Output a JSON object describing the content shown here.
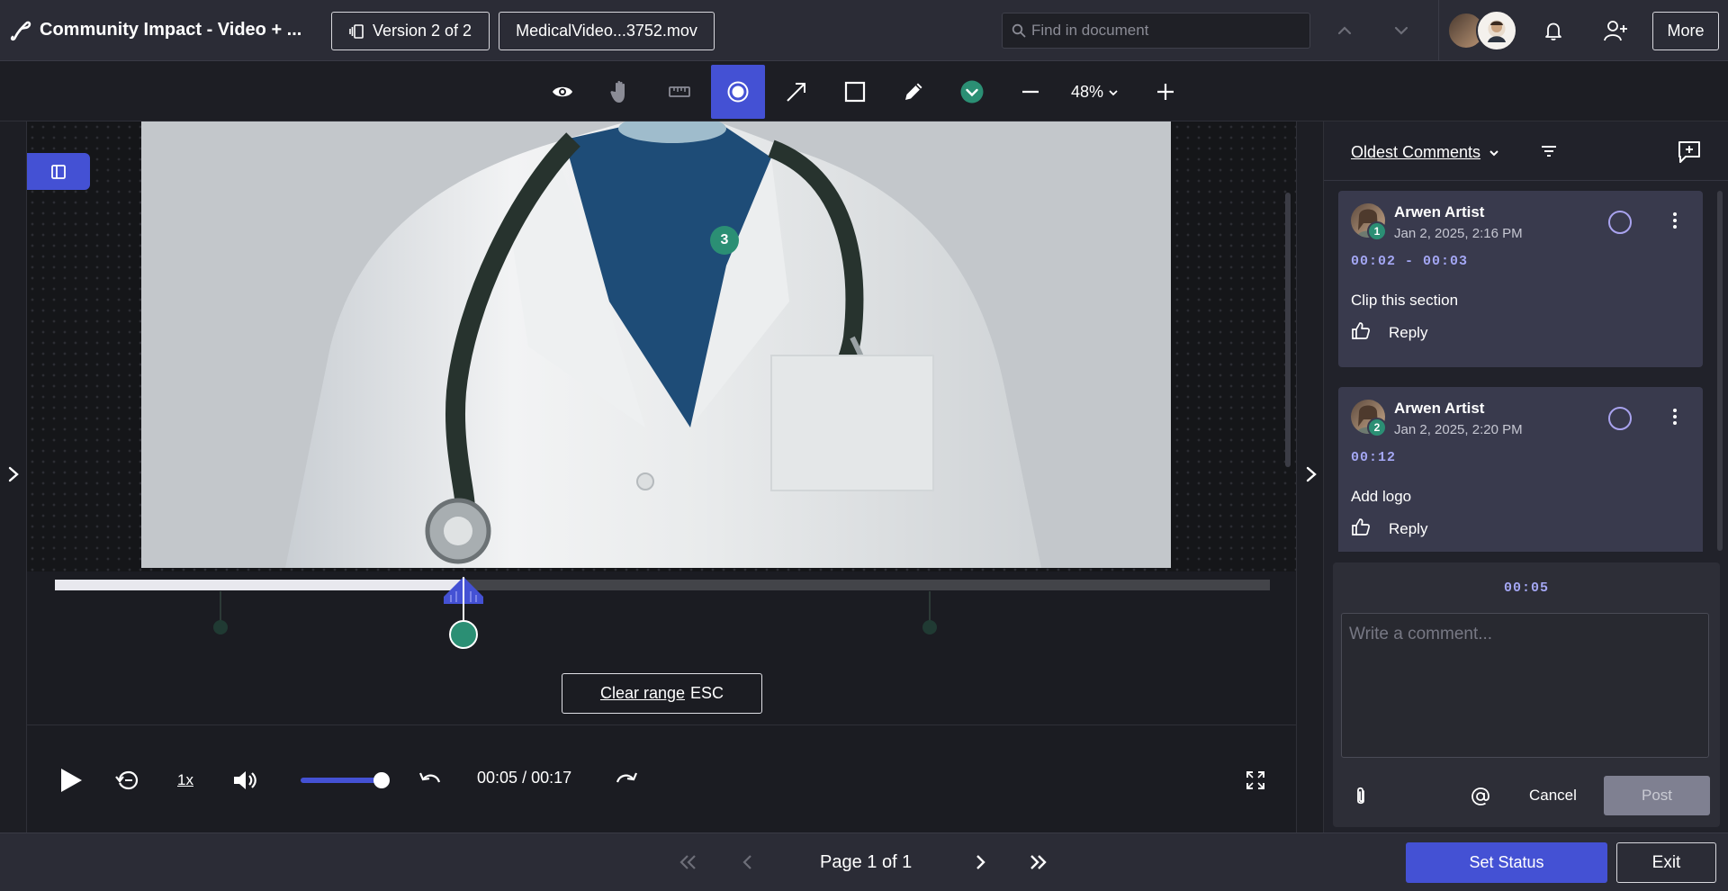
{
  "header": {
    "title": "Community Impact - Video + ...",
    "version_label": "Version 2 of 2",
    "file_label": "MedicalVideo...3752.mov",
    "search_placeholder": "Find in document",
    "more_label": "More"
  },
  "toolbar": {
    "zoom_level": "48%",
    "tools": [
      "eye-icon",
      "hand-icon",
      "ruler-icon",
      "record-icon",
      "arrow-icon",
      "square-icon",
      "pencil-icon",
      "status-check-icon"
    ],
    "active_tool": "record-icon"
  },
  "stage": {
    "marker_number": "3"
  },
  "timeline": {
    "progress_fraction": 0.336,
    "clear_range_label": "Clear range",
    "clear_range_key": "ESC"
  },
  "player": {
    "speed": "1x",
    "current_time": "00:05",
    "separator": "/",
    "duration": "00:17",
    "volume_fraction": 1.0
  },
  "sidebar": {
    "sort_label": "Oldest Comments",
    "comments": [
      {
        "number": "1",
        "author": "Arwen Artist",
        "date": "Jan 2, 2025, 2:16 PM",
        "time": "00:02 - 00:03",
        "text": "Clip this section",
        "reply_label": "Reply"
      },
      {
        "number": "2",
        "author": "Arwen Artist",
        "date": "Jan 2, 2025, 2:20 PM",
        "time": "00:12",
        "text": "Add logo",
        "reply_label": "Reply"
      }
    ],
    "composer": {
      "time": "00:05",
      "placeholder": "Write a comment...",
      "cancel_label": "Cancel",
      "post_label": "Post"
    }
  },
  "footer": {
    "page_label": "Page 1 of 1",
    "set_status_label": "Set Status",
    "exit_label": "Exit"
  },
  "colors": {
    "accent": "#4451d4",
    "marker_green": "#2b8f74",
    "timecode": "#a4a7f4",
    "card": "#393a4d"
  }
}
